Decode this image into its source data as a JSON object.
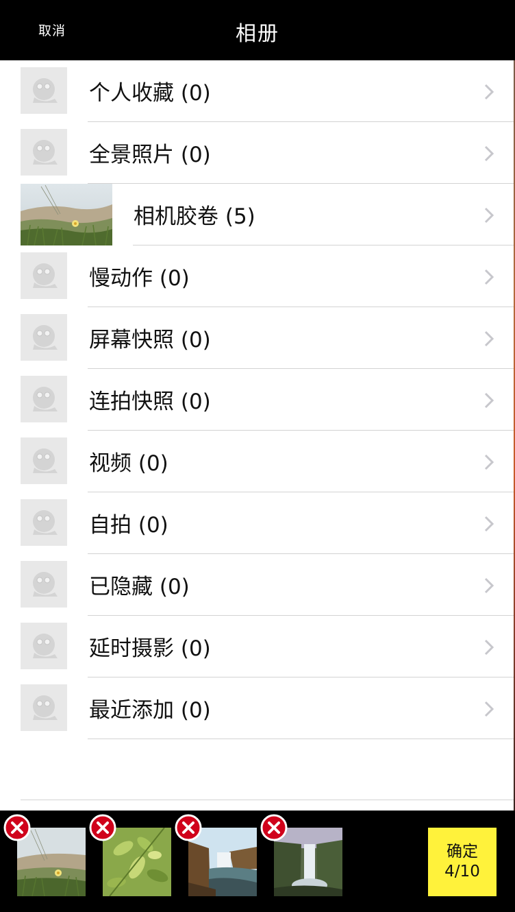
{
  "header": {
    "cancel_label": "取消",
    "title": "相册"
  },
  "albums": [
    {
      "label": "个人收藏 (0)",
      "thumb": "placeholder"
    },
    {
      "label": "全景照片 (0)",
      "thumb": "placeholder"
    },
    {
      "label": "相机胶卷 (5)",
      "thumb": "photo"
    },
    {
      "label": "慢动作 (0)",
      "thumb": "placeholder"
    },
    {
      "label": "屏幕快照 (0)",
      "thumb": "placeholder"
    },
    {
      "label": "连拍快照 (0)",
      "thumb": "placeholder"
    },
    {
      "label": "视频 (0)",
      "thumb": "placeholder"
    },
    {
      "label": "自拍 (0)",
      "thumb": "placeholder"
    },
    {
      "label": "已隐藏 (0)",
      "thumb": "placeholder"
    },
    {
      "label": "延时摄影 (0)",
      "thumb": "placeholder"
    },
    {
      "label": "最近添加 (0)",
      "thumb": "placeholder"
    }
  ],
  "selection": {
    "items": [
      "dune-grass-photo",
      "green-leaves-photo",
      "waterfall-canyon-photo",
      "waterfall-mist-photo"
    ],
    "confirm_label": "确定",
    "count_label": "4/10"
  },
  "colors": {
    "bar_background": "#000000",
    "confirm_button": "#fff23b",
    "remove_badge": "#d0021b",
    "separator": "#d2d2d2",
    "placeholder": "#e8e8e8"
  }
}
